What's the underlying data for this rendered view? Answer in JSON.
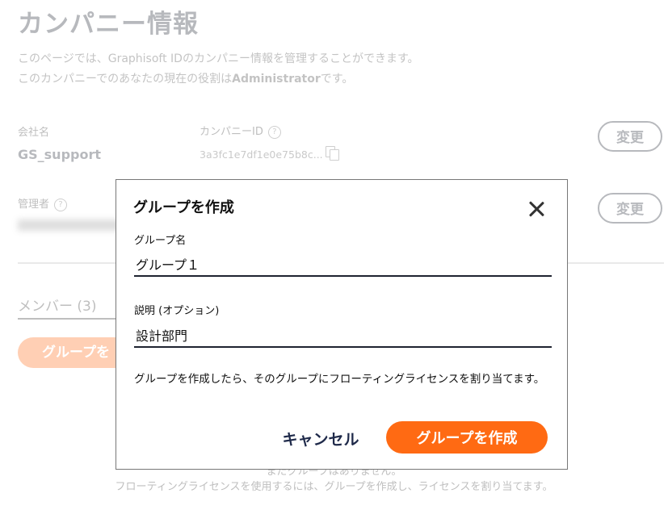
{
  "page": {
    "title": "カンパニー情報",
    "intro_line1": "このページでは、Graphisoft IDのカンパニー情報を管理することができます。",
    "intro_line2_prefix": "このカンパニーでのあなたの現在の役割は",
    "intro_line2_role": "Administrator",
    "intro_line2_suffix": "です。",
    "company_name_label": "会社名",
    "company_name_value": "GS_support",
    "company_id_label": "カンパニーID",
    "company_id_value": "3a3fc1e7df1e0e75b8c...",
    "admin_label": "管理者",
    "change_label_1": "変更",
    "change_label_2": "変更",
    "members_tab": "メンバー (3)",
    "create_group_partial": "グループを",
    "empty_line1": "まだグループはありません。",
    "empty_line2": "フローティングライセンスを使用するには、グループを作成し、ライセンスを割り当てます。"
  },
  "modal": {
    "title": "グループを作成",
    "group_name_label": "グループ名",
    "group_name_value": "グループ１",
    "description_label": "説明 (オプション)",
    "description_value": "設計部門",
    "note": "グループを作成したら、そのグループにフローティングライセンスを割り当てます。",
    "cancel_label": "キャンセル",
    "create_label": "グループを作成"
  },
  "colors": {
    "accent": "#ff6a13",
    "text_dark": "#1f2330"
  }
}
